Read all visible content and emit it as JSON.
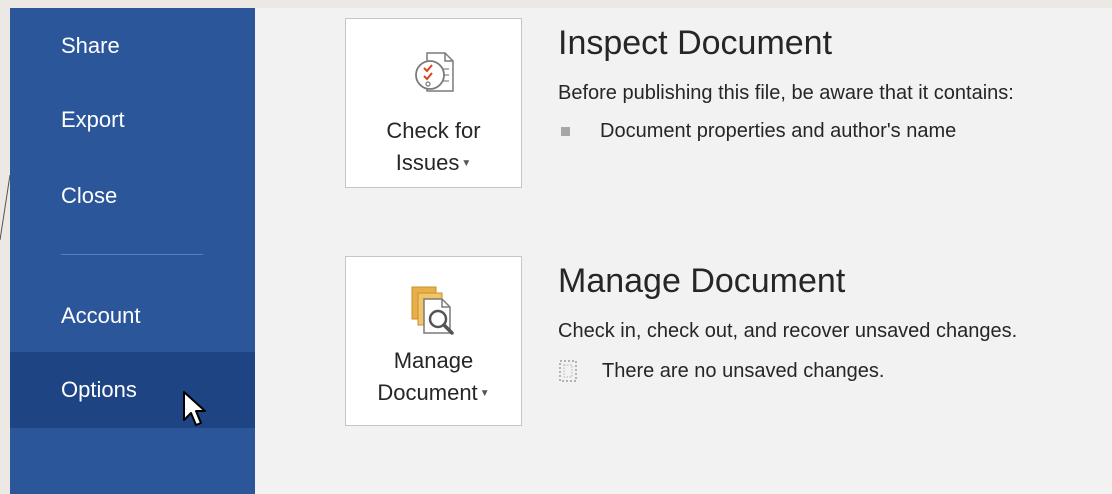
{
  "sidebar": {
    "items": [
      {
        "label": "Share"
      },
      {
        "label": "Export"
      },
      {
        "label": "Close"
      },
      {
        "label": "Account"
      },
      {
        "label": "Options"
      }
    ]
  },
  "inspect": {
    "button_line1": "Check for",
    "button_line2": "Issues",
    "title": "Inspect Document",
    "description": "Before publishing this file, be aware that it contains:",
    "bullet": "Document properties and author's name"
  },
  "manage": {
    "button_line1": "Manage",
    "button_line2": "Document",
    "title": "Manage Document",
    "description": "Check in, check out, and recover unsaved changes.",
    "status": "There are no unsaved changes."
  },
  "icons": {
    "inspect_tile": "checklist-document-icon",
    "manage_tile": "document-stack-magnifier-icon",
    "bullet": "square-bullet-icon",
    "status": "dotted-document-icon",
    "dropdown": "caret-down-icon",
    "cursor": "mouse-pointer-icon"
  },
  "colors": {
    "sidebar_bg": "#2b579a",
    "sidebar_hover": "#1e4484",
    "content_bg": "#f2f2f2",
    "text": "#262626"
  }
}
